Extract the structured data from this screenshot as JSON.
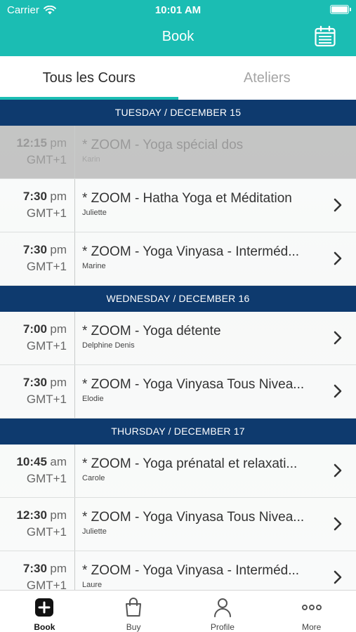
{
  "status_bar": {
    "carrier": "Carrier",
    "time": "10:01 AM"
  },
  "nav": {
    "title": "Book"
  },
  "tabs": [
    {
      "label": "Tous les Cours",
      "active": true
    },
    {
      "label": "Ateliers",
      "active": false
    }
  ],
  "days": [
    {
      "header": "TUESDAY / DECEMBER 15",
      "classes": [
        {
          "time": "12:15",
          "ampm": "pm",
          "tz": "GMT+1",
          "title": "* ZOOM - Yoga spécial dos",
          "teacher": "Karin",
          "past": true
        },
        {
          "time": "7:30",
          "ampm": "pm",
          "tz": "GMT+1",
          "title": "* ZOOM - Hatha Yoga et Méditation",
          "teacher": "Juliette",
          "past": false
        },
        {
          "time": "7:30",
          "ampm": "pm",
          "tz": "GMT+1",
          "title": "* ZOOM - Yoga Vinyasa - Interméd...",
          "teacher": "Marine",
          "past": false
        }
      ]
    },
    {
      "header": "WEDNESDAY / DECEMBER 16",
      "classes": [
        {
          "time": "7:00",
          "ampm": "pm",
          "tz": "GMT+1",
          "title": "* ZOOM - Yoga détente",
          "teacher": "Delphine Denis",
          "past": false
        },
        {
          "time": "7:30",
          "ampm": "pm",
          "tz": "GMT+1",
          "title": "* ZOOM - Yoga Vinyasa Tous Nivea...",
          "teacher": "Elodie",
          "past": false
        }
      ]
    },
    {
      "header": "THURSDAY / DECEMBER 17",
      "classes": [
        {
          "time": "10:45",
          "ampm": "am",
          "tz": "GMT+1",
          "title": "* ZOOM - Yoga prénatal et relaxati...",
          "teacher": "Carole",
          "past": false
        },
        {
          "time": "12:30",
          "ampm": "pm",
          "tz": "GMT+1",
          "title": "* ZOOM - Yoga Vinyasa Tous Nivea...",
          "teacher": "Juliette",
          "past": false
        },
        {
          "time": "7:30",
          "ampm": "pm",
          "tz": "GMT+1",
          "title": "* ZOOM - Yoga Vinyasa - Interméd...",
          "teacher": "Laure",
          "past": false
        }
      ]
    }
  ],
  "tabbar": [
    {
      "label": "Book",
      "icon": "plus-square-icon",
      "active": true
    },
    {
      "label": "Buy",
      "icon": "shopping-bag-icon",
      "active": false
    },
    {
      "label": "Profile",
      "icon": "person-icon",
      "active": false
    },
    {
      "label": "More",
      "icon": "ellipsis-icon",
      "active": false
    }
  ],
  "colors": {
    "accent": "#1bbdb3",
    "day_header": "#0e3a6e"
  }
}
